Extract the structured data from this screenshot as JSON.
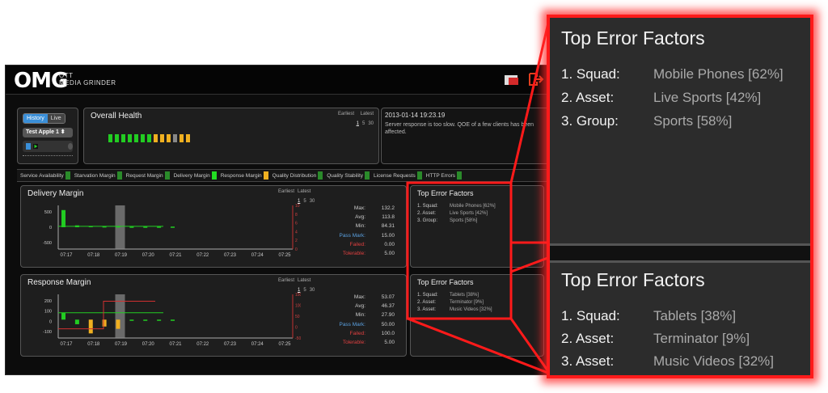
{
  "app": {
    "logo": "OMG",
    "logo_sub1": "OTT",
    "logo_sub2": "Media Grinder"
  },
  "mode": {
    "history": "History",
    "live": "Live",
    "selected": "History"
  },
  "source_select": "Test Apple 1",
  "health": {
    "title": "Overall Health",
    "earliest": "Earliest",
    "latest": "Latest",
    "range_1": "1",
    "range_5": "5",
    "range_30": "30",
    "bars": [
      "#22cc22",
      "#22cc22",
      "#22cc22",
      "#22cc22",
      "#22cc22",
      "#22cc22",
      "#22cc22",
      "#f0b020",
      "#f0b020",
      "#f0b020",
      "#888888",
      "#f0b020",
      "#f0b020"
    ]
  },
  "message": {
    "timestamp": "2013-01-14 19:23.19",
    "text": "Server response is too slow. QOE of a few clients has been affected."
  },
  "metrics": [
    {
      "label": "Service Availability",
      "color": "#2a8a2a"
    },
    {
      "label": "Starvation Margin",
      "color": "#2a8a2a"
    },
    {
      "label": "Request Margin",
      "color": "#2a8a2a"
    },
    {
      "label": "Delivery Margin",
      "color": "#22dd22"
    },
    {
      "label": "Response Margin",
      "color": "#f0b020"
    },
    {
      "label": "Quality Distribution",
      "color": "#2a8a2a"
    },
    {
      "label": "Quality Stability",
      "color": "#2a8a2a"
    },
    {
      "label": "License Requests",
      "color": "#2a8a2a"
    },
    {
      "label": "HTTP Errors",
      "color": "#2a8a2a"
    }
  ],
  "delivery": {
    "title": "Delivery Margin",
    "earliest": "Earliest",
    "latest": "Latest",
    "range_1": "1",
    "range_5": "5",
    "range_30": "30",
    "stats": {
      "max": "132.2",
      "avg": "113.8",
      "min": "84.31",
      "pass": "15.00",
      "failed": "0.00",
      "tolerable": "5.00"
    }
  },
  "response": {
    "title": "Response Margin",
    "earliest": "Earliest",
    "latest": "Latest",
    "range_1": "1",
    "range_5": "5",
    "range_30": "30",
    "stats": {
      "max": "53.07",
      "avg": "46.37",
      "min": "27.90",
      "pass": "50.00",
      "failed": "100.0",
      "tolerable": "5.00"
    }
  },
  "stat_labels": {
    "max": "Max:",
    "avg": "Avg:",
    "min": "Min:",
    "pass": "Pass Mark:",
    "failed": "Failed:",
    "tolerable": "Tolerable:"
  },
  "chart_data": [
    {
      "type": "bar",
      "title": "Delivery Margin",
      "categories": [
        "07:17",
        "07:18",
        "07:19",
        "07:20",
        "07:21",
        "07:22",
        "07:23",
        "07:24",
        "07:25"
      ],
      "y_ticks": [
        "500",
        "0",
        "-500"
      ],
      "y2_ticks": [
        "10",
        "8",
        "6",
        "4",
        "2",
        "0"
      ],
      "values": [
        550,
        60,
        40,
        30,
        30,
        20,
        20,
        20,
        20
      ]
    },
    {
      "type": "bar",
      "title": "Response Margin",
      "categories": [
        "07:17",
        "07:18",
        "07:19",
        "07:20",
        "07:21",
        "07:22",
        "07:23",
        "07:24",
        "07:25"
      ],
      "y_ticks": [
        "200",
        "100",
        "0",
        "-100"
      ],
      "y2_ticks": [
        "150",
        "100",
        "50",
        "0",
        "-50"
      ],
      "values": [
        60,
        -40,
        -120,
        -60,
        -80,
        0,
        0,
        0,
        0
      ]
    }
  ],
  "errors_top": {
    "title": "Top Error Factors",
    "rows": [
      {
        "k": "1. Squad:",
        "v": "Mobile Phones [62%]"
      },
      {
        "k": "2. Asset:",
        "v": "Live Sports [42%]"
      },
      {
        "k": "3. Group:",
        "v": "Sports [58%]"
      }
    ]
  },
  "errors_bottom": {
    "title": "Top Error Factors",
    "rows": [
      {
        "k": "1. Squad:",
        "v": "Tablets [38%]"
      },
      {
        "k": "2. Asset:",
        "v": "Terminator [9%]"
      },
      {
        "k": "3. Asset:",
        "v": "Music Videos [32%]"
      }
    ]
  }
}
